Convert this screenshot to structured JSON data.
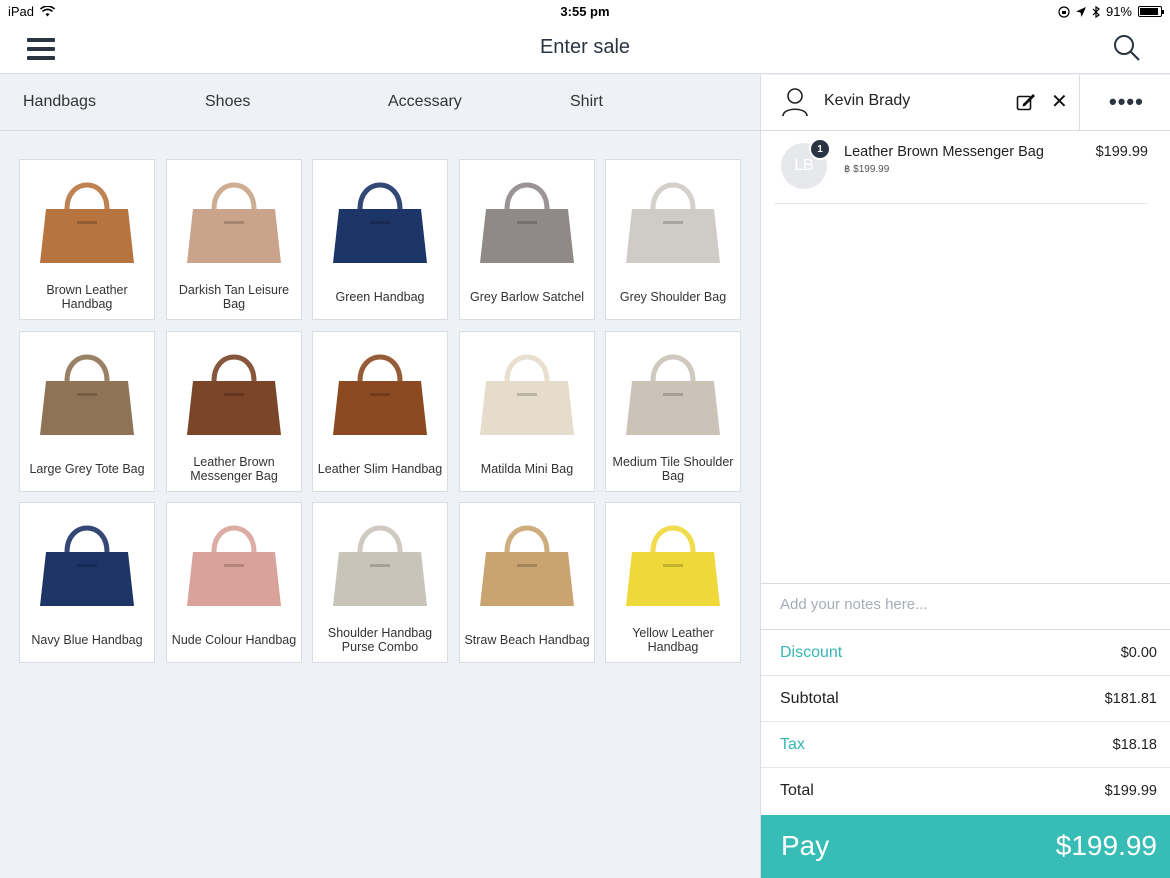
{
  "status_bar": {
    "device": "iPad",
    "time": "3:55 pm",
    "battery": "91%",
    "battery_level": 0.91
  },
  "header": {
    "title": "Enter sale"
  },
  "categories": [
    {
      "label": "Handbags",
      "active": true
    },
    {
      "label": "Shoes",
      "active": false
    },
    {
      "label": "Accessary",
      "active": false
    },
    {
      "label": "Shirt",
      "active": false
    }
  ],
  "products": [
    {
      "label": "Brown Leather Handbag",
      "color": "#b8743f"
    },
    {
      "label": "Darkish Tan Leisure Bag",
      "color": "#c9a48a"
    },
    {
      "label": "Green Handbag",
      "color": "#1d3566"
    },
    {
      "label": "Grey Barlow Satchel",
      "color": "#8f8a88"
    },
    {
      "label": "Grey Shoulder Bag",
      "color": "#cfcbc6"
    },
    {
      "label": "Large Grey Tote Bag",
      "color": "#8e7356"
    },
    {
      "label": "Leather Brown Messenger Bag",
      "color": "#7a4528"
    },
    {
      "label": "Leather Slim Handbag",
      "color": "#8b4a22"
    },
    {
      "label": "Matilda Mini Bag",
      "color": "#e6dccb"
    },
    {
      "label": "Medium Tile Shoulder Bag",
      "color": "#cbc3b8"
    },
    {
      "label": "Navy Blue Handbag",
      "color": "#1e3366"
    },
    {
      "label": "Nude Colour Handbag",
      "color": "#d9a39b"
    },
    {
      "label": "Shoulder Handbag Purse Combo",
      "color": "#c9c4b9"
    },
    {
      "label": "Straw Beach Handbag",
      "color": "#c9a471"
    },
    {
      "label": "Yellow Leather Handbag",
      "color": "#efd83a"
    }
  ],
  "sale": {
    "customer_name": "Kevin Brady",
    "items": [
      {
        "initials": "LB",
        "qty": "1",
        "name": "Leather Brown Messenger Bag",
        "sub": "฿ $199.99",
        "price": "$199.99"
      }
    ],
    "notes_placeholder": "Add your notes here...",
    "discount_label": "Discount",
    "discount_value": "$0.00",
    "subtotal_label": "Subtotal",
    "subtotal_value": "$181.81",
    "tax_label": "Tax",
    "tax_value": "$18.18",
    "total_label": "Total",
    "total_value": "$199.99",
    "pay_label": "Pay",
    "pay_amount": "$199.99"
  },
  "colors": {
    "accent": "#36b6b2",
    "pay_button": "#38bcb6",
    "dark": "#2b3542"
  }
}
